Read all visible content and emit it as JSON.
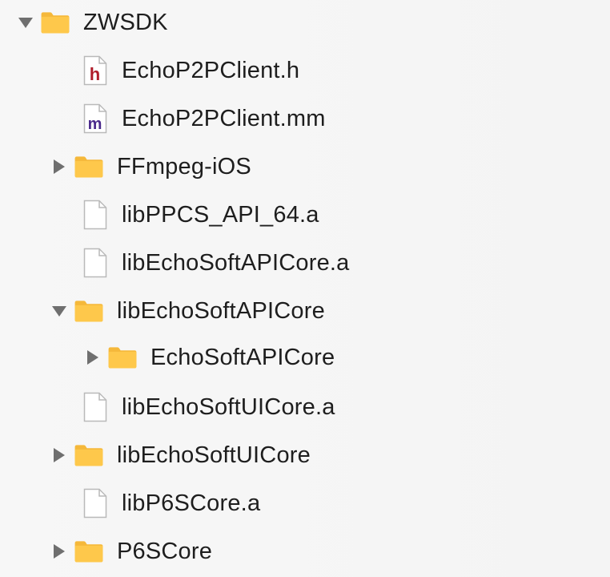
{
  "navigator": {
    "items": [
      {
        "label": "ZWSDK",
        "kind": "folder",
        "expanded": true,
        "icon": "folder-icon"
      },
      {
        "label": "EchoP2PClient.h",
        "kind": "header",
        "icon": "header-file-icon",
        "badge": "h"
      },
      {
        "label": "EchoP2PClient.mm",
        "kind": "source",
        "icon": "objc-source-file-icon",
        "badge": "m"
      },
      {
        "label": "FFmpeg-iOS",
        "kind": "folder",
        "expanded": false,
        "icon": "folder-icon"
      },
      {
        "label": "libPPCS_API_64.a",
        "kind": "file",
        "icon": "document-icon"
      },
      {
        "label": "libEchoSoftAPICore.a",
        "kind": "file",
        "icon": "document-icon"
      },
      {
        "label": "libEchoSoftAPICore",
        "kind": "folder",
        "expanded": true,
        "icon": "folder-icon"
      },
      {
        "label": "EchoSoftAPICore",
        "kind": "folder",
        "expanded": false,
        "icon": "folder-icon"
      },
      {
        "label": "libEchoSoftUICore.a",
        "kind": "file",
        "icon": "document-icon"
      },
      {
        "label": "libEchoSoftUICore",
        "kind": "folder",
        "expanded": false,
        "icon": "folder-icon"
      },
      {
        "label": "libP6SCore.a",
        "kind": "file",
        "icon": "document-icon"
      },
      {
        "label": "P6SCore",
        "kind": "folder",
        "expanded": false,
        "icon": "folder-icon"
      }
    ]
  },
  "colors": {
    "folder_fill": "#fec84b",
    "folder_tab": "#f5b83a",
    "folder_stroke": "#e0a020",
    "header_badge": "#b01c2a",
    "source_badge": "#4b2a8c",
    "disclosure": "#6f6f6f",
    "document_stroke": "#b9b9b9"
  }
}
